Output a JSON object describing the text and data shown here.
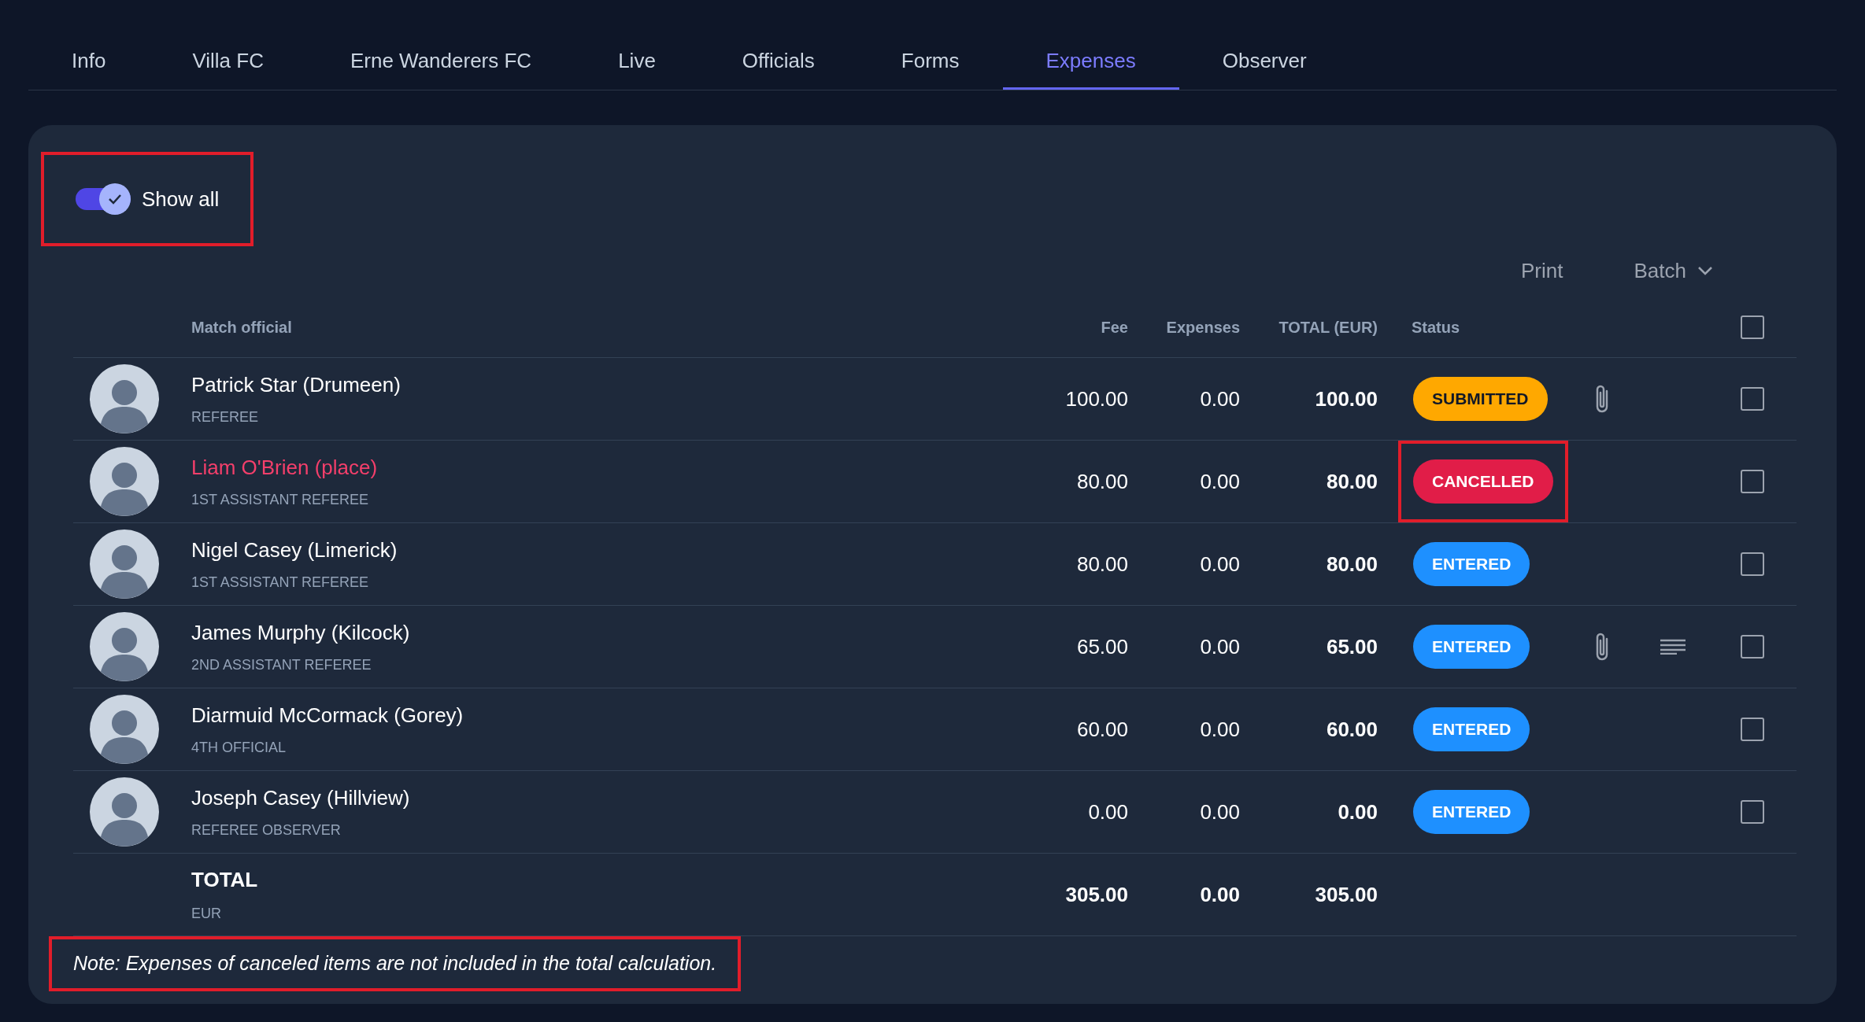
{
  "tabs": [
    {
      "label": "Info",
      "selected": false
    },
    {
      "label": "Villa FC",
      "selected": false
    },
    {
      "label": "Erne Wanderers FC",
      "selected": false
    },
    {
      "label": "Live",
      "selected": false
    },
    {
      "label": "Officials",
      "selected": false
    },
    {
      "label": "Forms",
      "selected": false
    },
    {
      "label": "Expenses",
      "selected": true
    },
    {
      "label": "Observer",
      "selected": false
    }
  ],
  "show_all": {
    "label": "Show all",
    "on": true,
    "highlighted": true
  },
  "actions": {
    "print": "Print",
    "batch": "Batch"
  },
  "table": {
    "columns": [
      "Match official",
      "Fee",
      "Expenses",
      "TOTAL (EUR)",
      "Status"
    ],
    "select_all_checked": false,
    "rows": [
      {
        "name": "Patrick Star (Drumeen)",
        "role": "REFEREE",
        "fee": "100.00",
        "expenses": "0.00",
        "total": "100.00",
        "status": "SUBMITTED",
        "kind": "submitted",
        "highlighted": false,
        "attachment": true,
        "notes": false,
        "checked": false
      },
      {
        "name": "Liam O'Brien (place)",
        "role": "1ST ASSISTANT REFEREE",
        "fee": "80.00",
        "expenses": "0.00",
        "total": "80.00",
        "status": "CANCELLED",
        "kind": "cancelled",
        "highlighted": true,
        "attachment": false,
        "notes": false,
        "checked": false
      },
      {
        "name": "Nigel Casey (Limerick)",
        "role": "1ST ASSISTANT REFEREE",
        "fee": "80.00",
        "expenses": "0.00",
        "total": "80.00",
        "status": "ENTERED",
        "kind": "entered",
        "highlighted": false,
        "attachment": false,
        "notes": false,
        "checked": false
      },
      {
        "name": "James Murphy (Kilcock)",
        "role": "2ND ASSISTANT REFEREE",
        "fee": "65.00",
        "expenses": "0.00",
        "total": "65.00",
        "status": "ENTERED",
        "kind": "entered",
        "highlighted": false,
        "attachment": true,
        "notes": true,
        "checked": false
      },
      {
        "name": "Diarmuid McCormack (Gorey)",
        "role": "4TH OFFICIAL",
        "fee": "60.00",
        "expenses": "0.00",
        "total": "60.00",
        "status": "ENTERED",
        "kind": "entered",
        "highlighted": false,
        "attachment": false,
        "notes": false,
        "checked": false
      },
      {
        "name": "Joseph Casey (Hillview)",
        "role": "REFEREE OBSERVER",
        "fee": "0.00",
        "expenses": "0.00",
        "total": "0.00",
        "status": "ENTERED",
        "kind": "entered",
        "highlighted": false,
        "attachment": false,
        "notes": false,
        "checked": false
      }
    ],
    "total": {
      "label": "TOTAL",
      "currency": "EUR",
      "fee": "305.00",
      "expenses": "0.00",
      "total": "305.00"
    }
  },
  "note": {
    "text": "Note: Expenses of canceled items are not included in the total calculation.",
    "highlighted": true
  }
}
